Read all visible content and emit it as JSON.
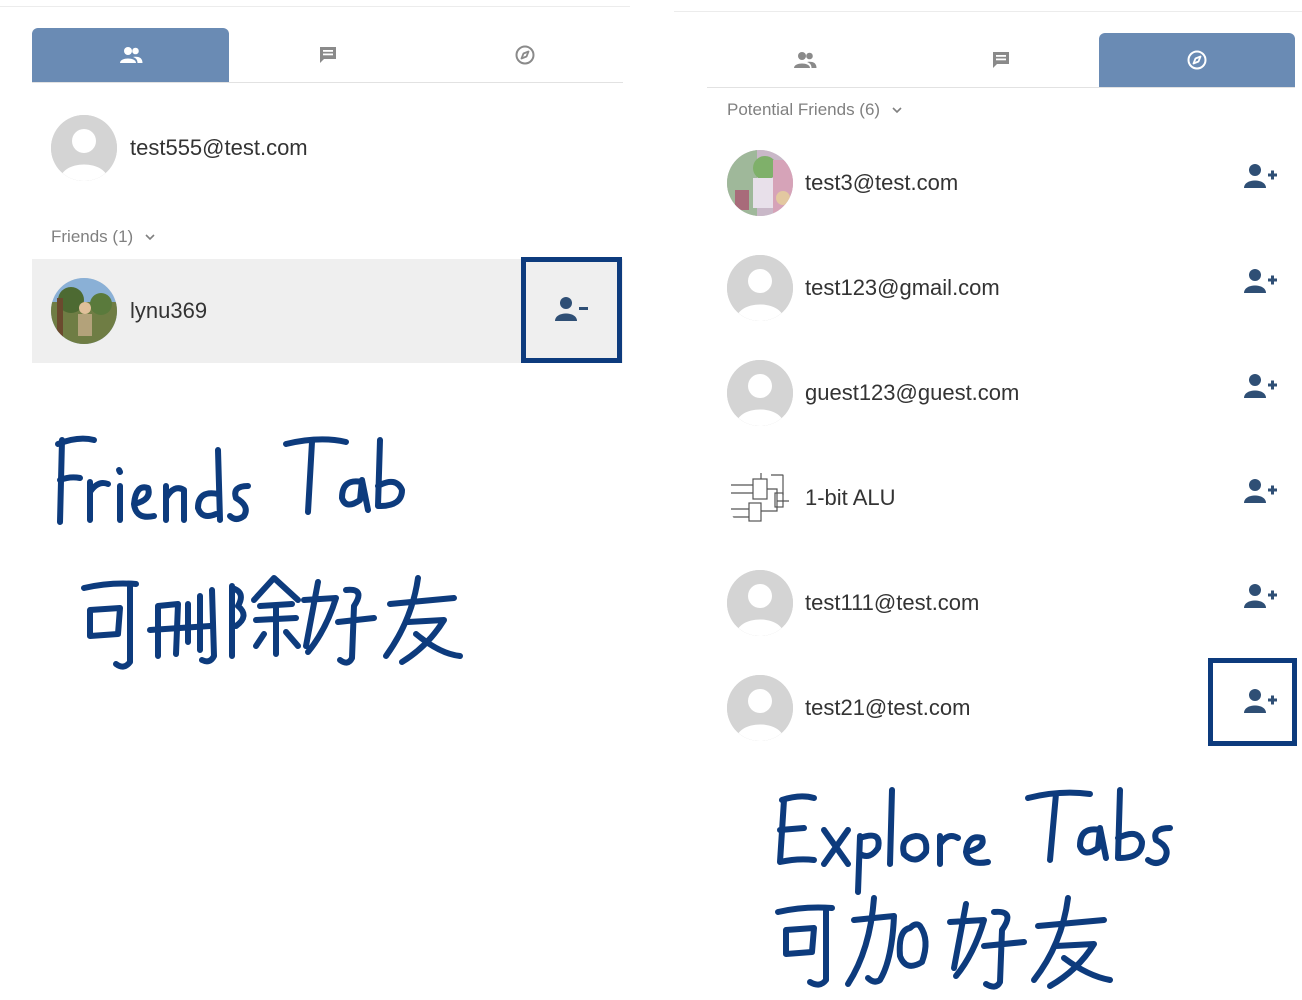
{
  "colors": {
    "active_tab": "#6a8bb4",
    "icon_gray": "#8a8a8a",
    "action_icon": "#2f4f75",
    "highlight": "#0d3b7d",
    "friend_row_bg": "#efefef"
  },
  "left_panel": {
    "tabs": [
      {
        "icon": "friends-icon",
        "active": true
      },
      {
        "icon": "chat-icon",
        "active": false
      },
      {
        "icon": "compass-icon",
        "active": false
      }
    ],
    "current_user": {
      "name": "test555@test.com",
      "avatar": "default-avatar"
    },
    "friends_section": {
      "label": "Friends (1)"
    },
    "friends": [
      {
        "name": "lynu369",
        "avatar": "photo-avatar",
        "action_icon": "remove-friend-icon"
      }
    ],
    "annotation": {
      "line1": "Friends Tab",
      "line2": "可删除好友"
    }
  },
  "right_panel": {
    "tabs": [
      {
        "icon": "friends-icon",
        "active": false
      },
      {
        "icon": "chat-icon",
        "active": false
      },
      {
        "icon": "compass-icon",
        "active": true
      }
    ],
    "potential_section": {
      "label": "Potential Friends (6)"
    },
    "potential_friends": [
      {
        "name": "test3@test.com",
        "avatar": "photo-avatar",
        "action_icon": "add-friend-icon"
      },
      {
        "name": "test123@gmail.com",
        "avatar": "default-avatar",
        "action_icon": "add-friend-icon"
      },
      {
        "name": "guest123@guest.com",
        "avatar": "default-avatar",
        "action_icon": "add-friend-icon"
      },
      {
        "name": "1-bit ALU",
        "avatar": "circuit-avatar",
        "action_icon": "add-friend-icon"
      },
      {
        "name": "test111@test.com",
        "avatar": "default-avatar",
        "action_icon": "add-friend-icon"
      },
      {
        "name": "test21@test.com",
        "avatar": "default-avatar",
        "action_icon": "add-friend-icon"
      }
    ],
    "annotation": {
      "line1": "Explore Tabs",
      "line2": "可加好友"
    }
  }
}
